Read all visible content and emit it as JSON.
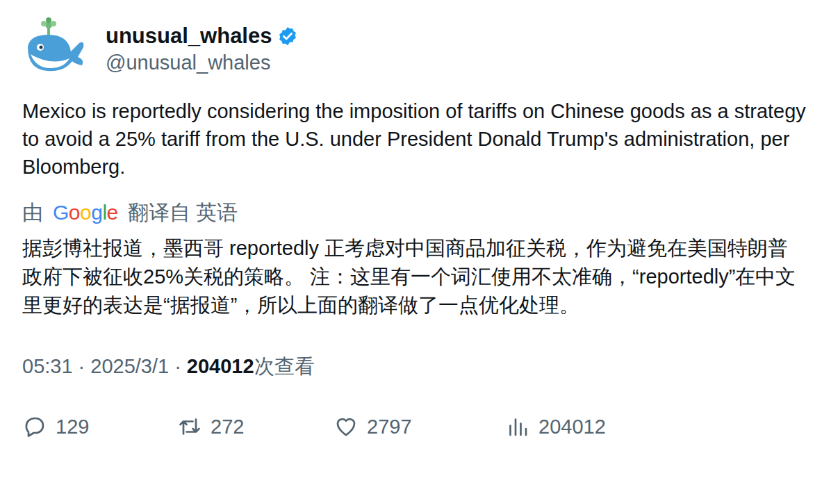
{
  "author": {
    "name": "unusual_whales",
    "handle": "@unusual_whales",
    "verified": true
  },
  "post": {
    "text": "Mexico is reportedly considering the imposition of tariffs on Chinese goods as a strategy to avoid a 25% tariff from the U.S. under President Donald Trump's administration, per Bloomberg.",
    "translation_label": {
      "prefix": "由",
      "brand": "Google",
      "suffix": "翻译自 英语"
    },
    "translation": "据彭博社报道，墨西哥 reportedly 正考虑对中国商品加征关税，作为避免在美国特朗普政府下被征收25%关税的策略。 注：这里有一个词汇使用不太准确，“reportedly”在中文里更好的表达是“据报道”，所以上面的翻译做了一点优化处理。",
    "time": "05:31",
    "separator": "·",
    "date": "2025/3/1",
    "views": "204012",
    "views_label": "次查看"
  },
  "actions": [
    {
      "name": "reply",
      "count": "129"
    },
    {
      "name": "repost",
      "count": "272"
    },
    {
      "name": "like",
      "count": "2797"
    },
    {
      "name": "views",
      "count": "204012"
    }
  ]
}
